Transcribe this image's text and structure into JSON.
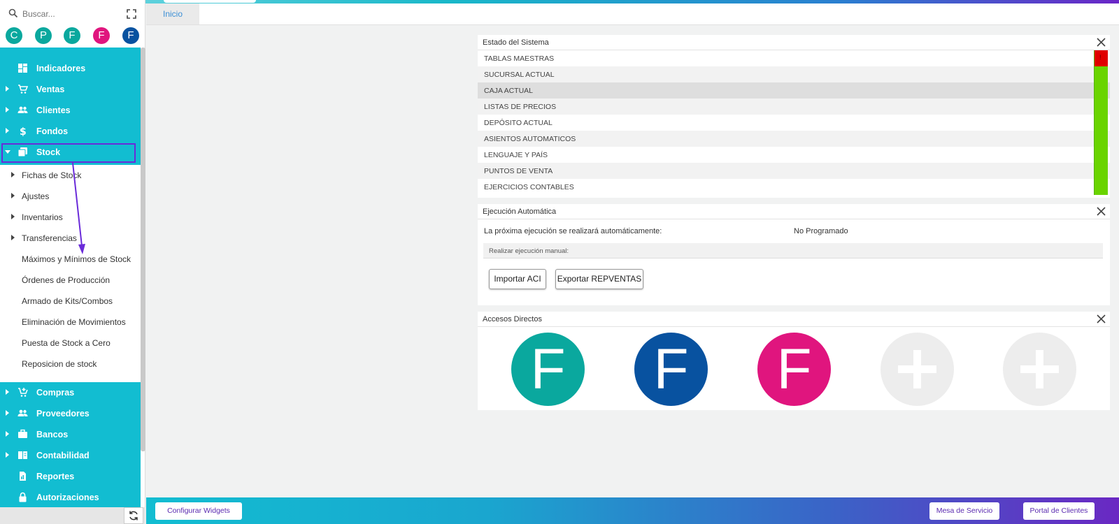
{
  "search": {
    "placeholder": "Buscar..."
  },
  "shortcuts": [
    {
      "letter": "C",
      "color": "#0aa89e"
    },
    {
      "letter": "P",
      "color": "#0aa89e"
    },
    {
      "letter": "F",
      "color": "#0aa89e"
    },
    {
      "letter": "F",
      "color": "#e0157e"
    },
    {
      "letter": "F",
      "color": "#0852a0"
    }
  ],
  "menu": {
    "top": [
      {
        "label": "Indicadores",
        "icon": "dashboard-icon",
        "expandable": false
      },
      {
        "label": "Ventas",
        "icon": "cart-icon",
        "expandable": true
      },
      {
        "label": "Clientes",
        "icon": "people-icon",
        "expandable": true
      },
      {
        "label": "Fondos",
        "icon": "dollar-icon",
        "expandable": true
      },
      {
        "label": "Stock",
        "icon": "stack-icon",
        "expandable": true,
        "expanded": true
      }
    ],
    "stock_sub": [
      {
        "label": "Fichas de Stock",
        "expandable": true
      },
      {
        "label": "Ajustes",
        "expandable": true
      },
      {
        "label": "Inventarios",
        "expandable": true
      },
      {
        "label": "Transferencias",
        "expandable": true
      },
      {
        "label": "Máximos y Mínimos de Stock",
        "expandable": false
      },
      {
        "label": "Órdenes de Producción",
        "expandable": false
      },
      {
        "label": "Armado de Kits/Combos",
        "expandable": false
      },
      {
        "label": "Eliminación de Movimientos",
        "expandable": false
      },
      {
        "label": "Puesta de Stock a Cero",
        "expandable": false
      },
      {
        "label": "Reposicion de stock",
        "expandable": false
      }
    ],
    "bottom": [
      {
        "label": "Compras",
        "icon": "cart-add-icon",
        "expandable": true
      },
      {
        "label": "Proveedores",
        "icon": "people-icon",
        "expandable": true
      },
      {
        "label": "Bancos",
        "icon": "briefcase-icon",
        "expandable": true
      },
      {
        "label": "Contabilidad",
        "icon": "book-icon",
        "expandable": true
      },
      {
        "label": "Reportes",
        "icon": "report-icon",
        "expandable": false
      },
      {
        "label": "Autorizaciones",
        "icon": "lock-icon",
        "expandable": false
      }
    ]
  },
  "tabs": [
    {
      "label": "Inicio"
    }
  ],
  "estado": {
    "title": "Estado del Sistema",
    "rows": [
      {
        "label": "TABLAS MAESTRAS",
        "status": "error",
        "mark": "!"
      },
      {
        "label": "SUCURSAL ACTUAL",
        "status": "ok"
      },
      {
        "label": "CAJA ACTUAL",
        "status": "ok"
      },
      {
        "label": "LISTAS DE PRECIOS",
        "status": "ok"
      },
      {
        "label": "DEPÓSITO ACTUAL",
        "status": "ok"
      },
      {
        "label": "ASIENTOS AUTOMATICOS",
        "status": "ok"
      },
      {
        "label": "LENGUAJE Y PAÍS",
        "status": "ok"
      },
      {
        "label": "PUNTOS DE VENTA",
        "status": "ok"
      },
      {
        "label": "EJERCICIOS CONTABLES",
        "status": "ok"
      }
    ],
    "colors": {
      "ok": "#6ad400",
      "error": "#e00000"
    }
  },
  "ejecucion": {
    "title": "Ejecución Automática",
    "label": "La próxima ejecución se realizará automáticamente:",
    "value": "No Programado",
    "manual": "Realizar ejecución manual:",
    "buttons": [
      "Importar ACI",
      "Exportar REPVENTAS"
    ]
  },
  "accesos": {
    "title": "Accesos Directos",
    "items": [
      {
        "letter": "F",
        "color": "#0aa89e"
      },
      {
        "letter": "F",
        "color": "#0852a0"
      },
      {
        "letter": "F",
        "color": "#e0157e"
      },
      {
        "letter": "",
        "icon": "plus-icon",
        "color": "#ededed"
      },
      {
        "letter": "",
        "icon": "plus-icon",
        "color": "#ededed"
      }
    ]
  },
  "footer": {
    "configurar": "Configurar Widgets",
    "mesa": "Mesa de Servicio",
    "portal": "Portal de Clientes"
  }
}
